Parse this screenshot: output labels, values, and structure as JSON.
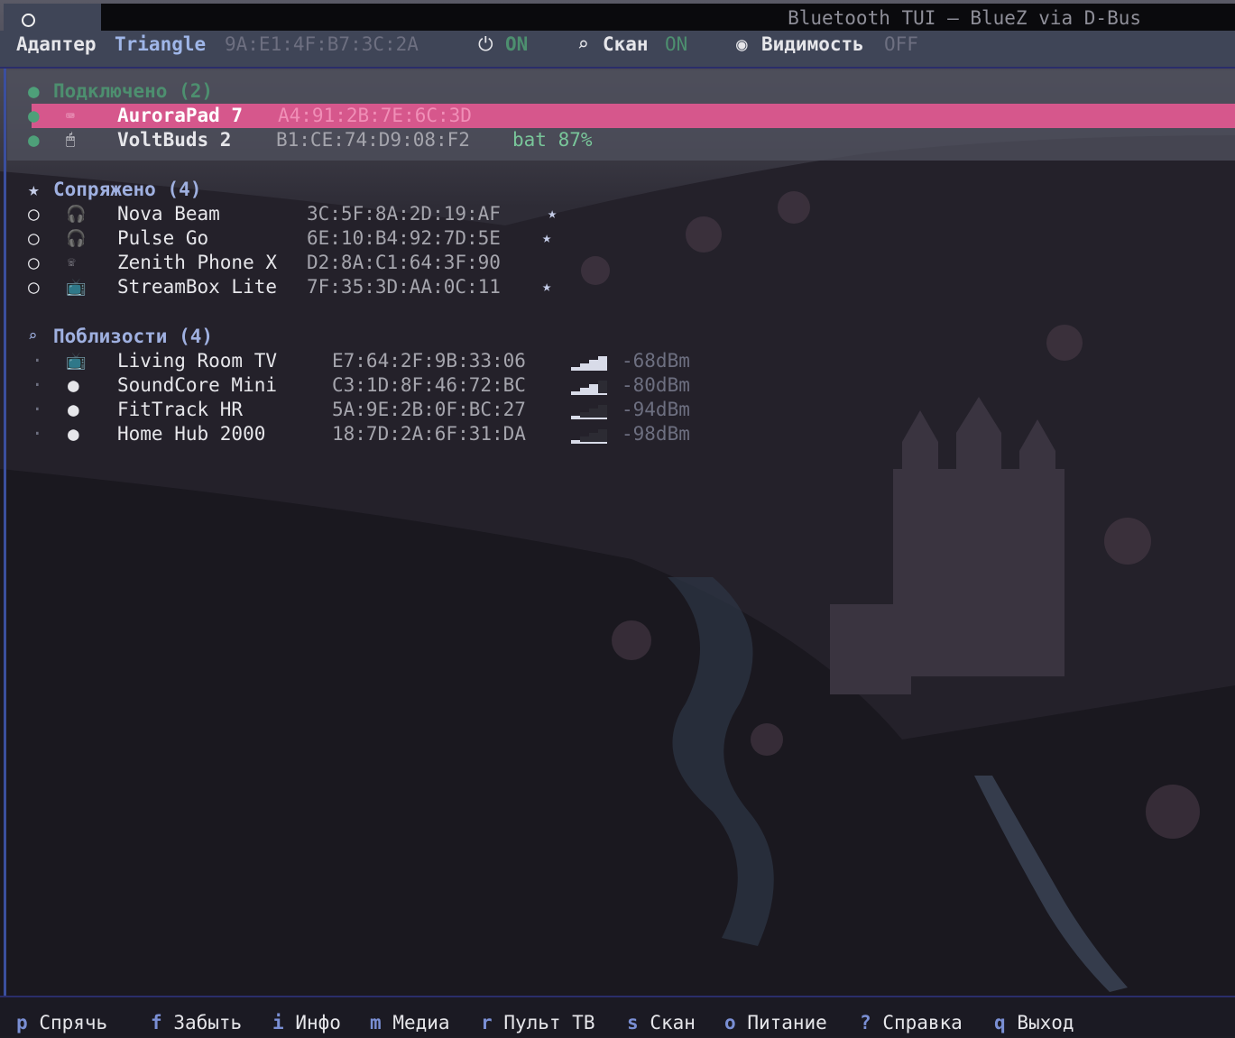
{
  "window": {
    "title": "Bluetooth TUI — BlueZ via D-Bus"
  },
  "status": {
    "adapter_label": "Адаптер",
    "adapter_name": "Triangle",
    "adapter_mac": "9A:E1:4F:B7:3C:2A",
    "power_icon": "⏻",
    "power_value": "ON",
    "scan_icon": "⌕",
    "scan_label": "Скан",
    "scan_value": "ON",
    "visibility_icon": "◉",
    "visibility_label": "Видимость",
    "visibility_value": "OFF"
  },
  "sections": {
    "connected": {
      "icon": "●",
      "title": "Подключено (2)",
      "devices": [
        {
          "state": "●",
          "icon": "⌨",
          "icon_name": "keyboard-icon",
          "name": "AuroraPad 7",
          "mac": "A4:91:2B:7E:6C:3D",
          "extra": "",
          "selected": true
        },
        {
          "state": "●",
          "icon": "🖱",
          "icon_name": "mouse-icon",
          "name": "VoltBuds 2",
          "mac": "B1:CE:74:D9:08:F2",
          "extra": "bat 87%",
          "selected": false
        }
      ]
    },
    "paired": {
      "icon": "★",
      "title": "Сопряжено (4)",
      "devices": [
        {
          "state": "○",
          "icon": "🎧",
          "icon_name": "headphones-icon",
          "name": "Nova Beam",
          "mac": "3C:5F:8A:2D:19:AF",
          "star": "★"
        },
        {
          "state": "○",
          "icon": "🎧",
          "icon_name": "headphones-icon",
          "name": "Pulse Go",
          "mac": "6E:10:B4:92:7D:5E",
          "star": "★"
        },
        {
          "state": "○",
          "icon": "☏",
          "icon_name": "phone-icon",
          "name": "Zenith Phone X",
          "mac": "D2:8A:C1:64:3F:90",
          "star": ""
        },
        {
          "state": "○",
          "icon": "📺",
          "icon_name": "tv-icon",
          "name": "StreamBox Lite",
          "mac": "7F:35:3D:AA:0C:11",
          "star": "★"
        }
      ]
    },
    "nearby": {
      "icon": "⌕",
      "title": "Поблизости (4)",
      "devices": [
        {
          "state": "·",
          "icon": "📺",
          "icon_name": "tv-icon",
          "name": "Living Room TV",
          "mac": "E7:64:2F:9B:33:06",
          "rssi": "-68dBm",
          "signal_level": 4
        },
        {
          "state": "·",
          "icon": "●",
          "icon_name": "device-dot-icon",
          "name": "SoundCore Mini",
          "mac": "C3:1D:8F:46:72:BC",
          "rssi": "-80dBm",
          "signal_level": 3
        },
        {
          "state": "·",
          "icon": "●",
          "icon_name": "device-dot-icon",
          "name": "FitTrack HR",
          "mac": "5A:9E:2B:0F:BC:27",
          "rssi": "-94dBm",
          "signal_level": 1
        },
        {
          "state": "·",
          "icon": "●",
          "icon_name": "device-dot-icon",
          "name": "Home Hub 2000",
          "mac": "18:7D:2A:6F:31:DA",
          "rssi": "-98dBm",
          "signal_level": 1
        }
      ]
    }
  },
  "keybar": [
    {
      "key": "p",
      "label": "Спрячь"
    },
    {
      "key": "f",
      "label": "Забыть"
    },
    {
      "key": "i",
      "label": "Инфо"
    },
    {
      "key": "m",
      "label": "Медиа"
    },
    {
      "key": "r",
      "label": "Пульт ТВ"
    },
    {
      "key": "s",
      "label": "Скан"
    },
    {
      "key": "o",
      "label": "Питание"
    },
    {
      "key": "?",
      "label": "Справка"
    },
    {
      "key": "q",
      "label": "Выход"
    }
  ],
  "colors": {
    "selection": "#d6578c",
    "accent": "#7a8fd4",
    "connected_green": "#4ea079"
  }
}
